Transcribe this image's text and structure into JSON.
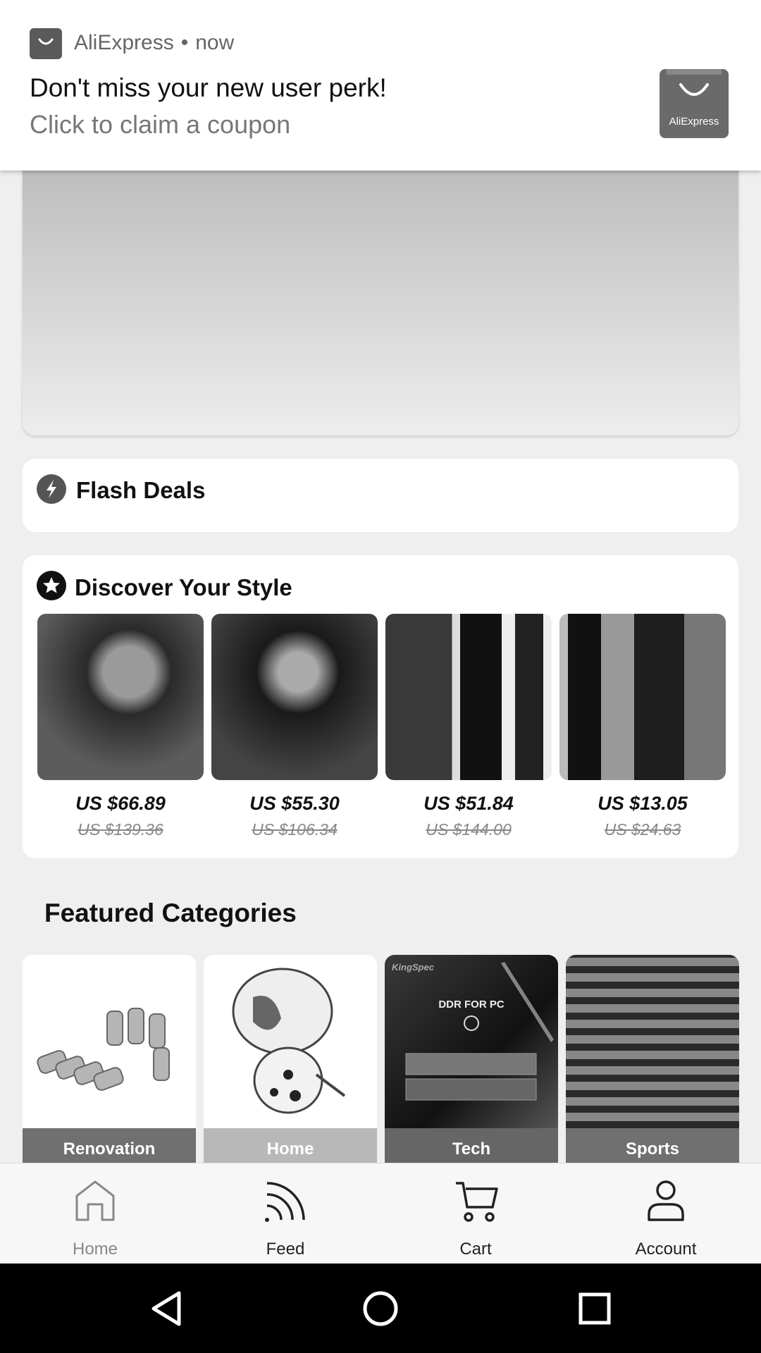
{
  "notification": {
    "app_name": "AliExpress",
    "time": "now",
    "title": "Don't miss your new user perk!",
    "text": "Click to claim a  coupon",
    "thumb_logo": "AliExpress"
  },
  "flash_deals": {
    "title": "Flash Deals",
    "icon": "lightning-icon"
  },
  "discover": {
    "title": "Discover Your Style",
    "icon": "star-badge-icon",
    "products": [
      {
        "price": "US $66.89",
        "old_price": "US $139.36"
      },
      {
        "price": "US $55.30",
        "old_price": "US $106.34"
      },
      {
        "price": "US $51.84",
        "old_price": "US $144.00"
      },
      {
        "price": "US $13.05",
        "old_price": "US $24.63"
      }
    ]
  },
  "featured": {
    "title": "Featured Categories",
    "categories": [
      {
        "label": "Renovation"
      },
      {
        "label": "Home"
      },
      {
        "label": "Tech",
        "image_text": "DDR FOR PC",
        "brand": "KingSpec"
      },
      {
        "label": "Sports"
      }
    ]
  },
  "bottom_nav": {
    "items": [
      {
        "label": "Home",
        "icon": "home-icon"
      },
      {
        "label": "Feed",
        "icon": "feed-icon"
      },
      {
        "label": "Cart",
        "icon": "cart-icon"
      },
      {
        "label": "Account",
        "icon": "account-icon"
      }
    ]
  }
}
